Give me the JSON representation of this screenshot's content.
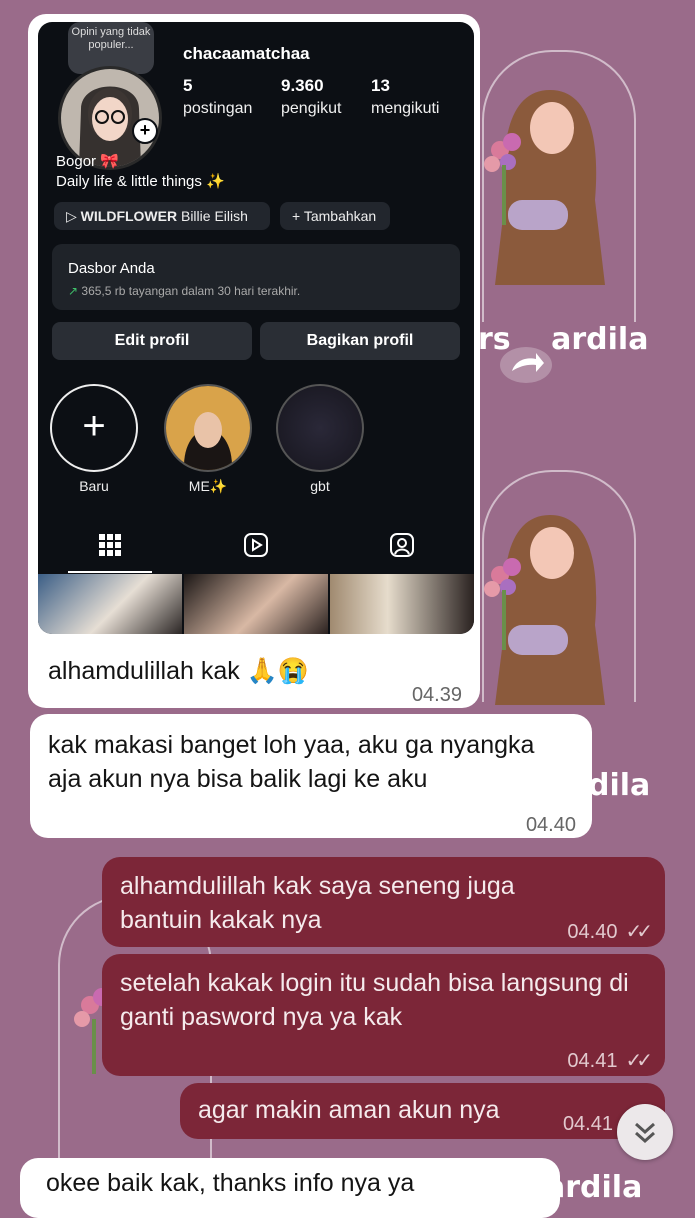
{
  "watermark": {
    "text_top": "ardila",
    "text_top_prefix": "rs",
    "text_mid": "dila",
    "text_bottom": "ardila"
  },
  "instagram": {
    "note": "Opini yang tidak populer...",
    "username": "chacaamatchaa",
    "stats": [
      {
        "value": "5",
        "label": "postingan"
      },
      {
        "value": "9.360",
        "label": "pengikut"
      },
      {
        "value": "13",
        "label": "mengikuti"
      }
    ],
    "bio_line1": "Bogor 🎀",
    "bio_line2": "Daily life & little things ✨",
    "music_title": "WILDFLOWER",
    "music_artist": "Billie Eilish",
    "add_label": "Tambahkan",
    "dashboard_title": "Dasbor Anda",
    "dashboard_stat": "365,5 rb tayangan dalam 30 hari terakhir.",
    "edit_profile": "Edit profil",
    "share_profile": "Bagikan profil",
    "highlights": [
      "Baru",
      "ME✨",
      "gbt"
    ]
  },
  "messages": [
    {
      "side": "in",
      "text": "alhamdulillah kak 🙏😭",
      "time": "04.39"
    },
    {
      "side": "in",
      "text": "kak makasi banget loh yaa, aku ga nyangka aja akun nya bisa balik lagi ke aku",
      "time": "04.40"
    },
    {
      "side": "out",
      "text": "alhamdulillah kak saya seneng juga bantuin kakak nya",
      "time": "04.40"
    },
    {
      "side": "out",
      "text": "setelah kakak login itu sudah bisa langsung di ganti pasword nya ya kak",
      "time": "04.41"
    },
    {
      "side": "out",
      "text": "agar makin aman akun nya",
      "time": "04.41"
    },
    {
      "side": "in",
      "text": "okee baik kak, thanks info nya ya",
      "time": ""
    }
  ],
  "colors": {
    "background": "#9a6b8a",
    "incoming": "#ffffff",
    "outgoing": "#7c2638"
  }
}
